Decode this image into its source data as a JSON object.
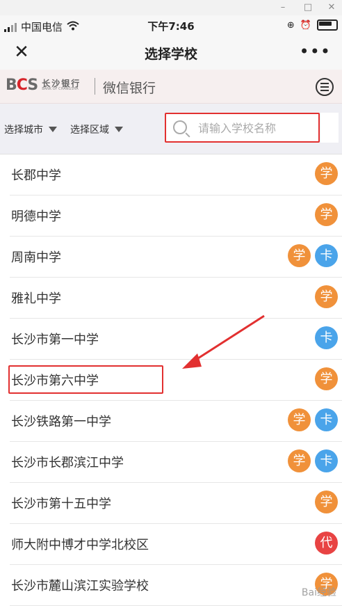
{
  "status_bar": {
    "carrier": "中国电信",
    "time": "下午7:46"
  },
  "nav": {
    "title": "选择学校"
  },
  "bank": {
    "logo_text": "BCS",
    "logo_cn": "长沙银行",
    "logo_en": "BANK OF CHANGSHA",
    "service": "微信银行"
  },
  "filter": {
    "city_label": "选择城市",
    "district_label": "选择区域",
    "search_placeholder": "请输入学校名称"
  },
  "schools": [
    {
      "name": "长郡中学",
      "badges": [
        "学"
      ]
    },
    {
      "name": "明德中学",
      "badges": [
        "学"
      ]
    },
    {
      "name": "周南中学",
      "badges": [
        "学",
        "卡"
      ]
    },
    {
      "name": "雅礼中学",
      "badges": [
        "学"
      ]
    },
    {
      "name": "长沙市第一中学",
      "badges": [
        "卡"
      ]
    },
    {
      "name": "长沙市第六中学",
      "badges": [
        "学"
      ]
    },
    {
      "name": "长沙铁路第一中学",
      "badges": [
        "学",
        "卡"
      ]
    },
    {
      "name": "长沙市长郡滨江中学",
      "badges": [
        "学",
        "卡"
      ]
    },
    {
      "name": "长沙市第十五中学",
      "badges": [
        "学"
      ]
    },
    {
      "name": "师大附中博才中学北校区",
      "badges": [
        "代"
      ]
    },
    {
      "name": "长沙市麓山滨江实验学校",
      "badges": [
        "学"
      ]
    }
  ],
  "badge_colors": {
    "学": "#f0913a",
    "卡": "#4aa4ea",
    "代": "#e84343"
  },
  "watermark": "Bai经验"
}
